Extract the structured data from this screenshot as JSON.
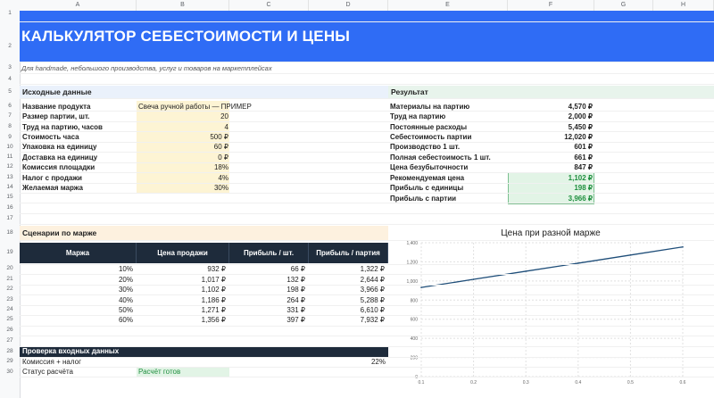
{
  "columns": [
    "A",
    "B",
    "C",
    "D",
    "E",
    "F",
    "G",
    "H"
  ],
  "rows": [
    "1",
    "2",
    "3",
    "4",
    "5",
    "6",
    "7",
    "8",
    "9",
    "10",
    "11",
    "12",
    "13",
    "14",
    "15",
    "16",
    "17",
    "18",
    "19",
    "20",
    "21",
    "22",
    "23",
    "24",
    "25",
    "26",
    "27",
    "28",
    "29",
    "30"
  ],
  "title": "КАЛЬКУЛЯТОР СЕБЕСТОИМОСТИ И ЦЕНЫ",
  "subtitle": "Для handmade, небольшого производства, услуг и товаров на маркетплейсах",
  "inputs": {
    "header": "Исходные данные",
    "items": [
      {
        "label": "Название продукта",
        "value": "Свеча ручной работы — ПРИМЕР"
      },
      {
        "label": "Размер партии, шт.",
        "value": "20"
      },
      {
        "label": "Труд на партию, часов",
        "value": "4"
      },
      {
        "label": "Стоимость часа",
        "value": "500 ₽"
      },
      {
        "label": "Упаковка на единицу",
        "value": "60 ₽"
      },
      {
        "label": "Доставка на единицу",
        "value": "0 ₽"
      },
      {
        "label": "Комиссия площадки",
        "value": "18%"
      },
      {
        "label": "Налог с продажи",
        "value": "4%"
      },
      {
        "label": "Желаемая маржа",
        "value": "30%"
      }
    ]
  },
  "results": {
    "header": "Результат",
    "items": [
      {
        "label": "Материалы на партию",
        "value": "4,570 ₽"
      },
      {
        "label": "Труд на партию",
        "value": "2,000 ₽"
      },
      {
        "label": "Постоянные расходы",
        "value": "5,450 ₽"
      },
      {
        "label": "Себестоимость партии",
        "value": "12,020 ₽"
      },
      {
        "label": "Производство 1 шт.",
        "value": "601 ₽"
      },
      {
        "label": "Полная себестоимость 1 шт.",
        "value": "661 ₽"
      },
      {
        "label": "Цена безубыточности",
        "value": "847 ₽"
      },
      {
        "label": "Рекомендуемая цена",
        "value": "1,102 ₽"
      },
      {
        "label": "Прибыль с единицы",
        "value": "198 ₽"
      },
      {
        "label": "Прибыль с партии",
        "value": "3,966 ₽"
      }
    ]
  },
  "scenarios": {
    "header": "Сценарии по марже",
    "columns": [
      "Маржа",
      "Цена продажи",
      "Прибыль / шт.",
      "Прибыль / партия"
    ],
    "rows": [
      [
        "10%",
        "932 ₽",
        "66 ₽",
        "1,322 ₽"
      ],
      [
        "20%",
        "1,017 ₽",
        "132 ₽",
        "2,644 ₽"
      ],
      [
        "30%",
        "1,102 ₽",
        "198 ₽",
        "3,966 ₽"
      ],
      [
        "40%",
        "1,186 ₽",
        "264 ₽",
        "5,288 ₽"
      ],
      [
        "50%",
        "1,271 ₽",
        "331 ₽",
        "6,610 ₽"
      ],
      [
        "60%",
        "1,356 ₽",
        "397 ₽",
        "7,932 ₽"
      ]
    ]
  },
  "check": {
    "header": "Проверка входных данных",
    "rows": [
      {
        "label": "Комиссия + налог",
        "value": "22%"
      },
      {
        "label": "Статус расчёта",
        "value": "Расчёт готов"
      }
    ]
  },
  "colors": {
    "accent": "#2f6cf5",
    "dark": "#1e2b3b",
    "green": "#1e8e3e",
    "line": "#1f4e79"
  },
  "chart_data": {
    "type": "line",
    "title": "Цена при разной марже",
    "x": [
      0.1,
      0.2,
      0.3,
      0.4,
      0.5,
      0.6
    ],
    "series": [
      {
        "values": [
          932,
          1017,
          1102,
          1186,
          1271,
          1356
        ]
      }
    ],
    "xticks": [
      "0.1",
      "0.2",
      "0.3",
      "0.4",
      "0.5",
      "0.6"
    ],
    "yticks": [
      "0",
      "200",
      "400",
      "600",
      "800",
      "1,000",
      "1,200",
      "1,400"
    ],
    "xlim": [
      0.1,
      0.6
    ],
    "ylim": [
      0,
      1400
    ],
    "grid": true
  }
}
